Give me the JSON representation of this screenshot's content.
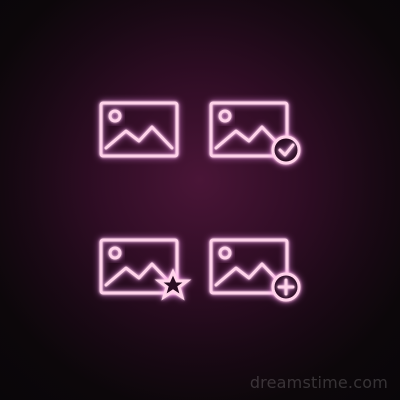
{
  "watermark": {
    "text": "dreamstime.com"
  },
  "icons": [
    {
      "name": "image-icon"
    },
    {
      "name": "image-check-icon"
    },
    {
      "name": "image-star-icon"
    },
    {
      "name": "image-plus-icon"
    }
  ],
  "colors": {
    "background": "#2b0b22",
    "neon": "#ff5fb7",
    "neon_core": "#ffd3ea"
  }
}
